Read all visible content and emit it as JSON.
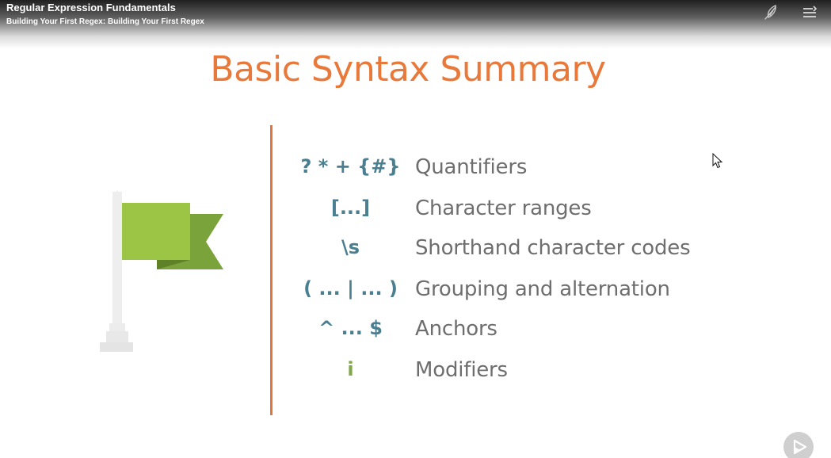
{
  "header": {
    "course_title": "Regular Expression Fundamentals",
    "module_title": "Building Your First Regex: Building Your First Regex"
  },
  "slide": {
    "title": "Basic Syntax Summary",
    "rows": [
      {
        "symbol": "? * + {#}",
        "description": "Quantifiers"
      },
      {
        "symbol": "[...]",
        "description": "Character ranges"
      },
      {
        "symbol": "\\s",
        "description": "Shorthand character codes"
      },
      {
        "symbol": "( ... | ... )",
        "description": "Grouping and alternation"
      },
      {
        "symbol": "^ ... $",
        "description": "Anchors"
      },
      {
        "symbol": "i",
        "description": "Modifiers"
      }
    ]
  },
  "icons": {
    "bookmark": "feather-icon",
    "toc": "table-of-contents-icon",
    "play": "play-icon",
    "flag": "flag-icon",
    "cursor": "mouse-cursor-icon"
  },
  "colors": {
    "title": "#e8793a",
    "divider": "#e1753b",
    "symbol": "#4a7f91",
    "symbol_modifier": "#7fa84a",
    "description": "#6e6e6e",
    "flag_front": "#9dc545",
    "flag_back": "#7aa33b"
  }
}
